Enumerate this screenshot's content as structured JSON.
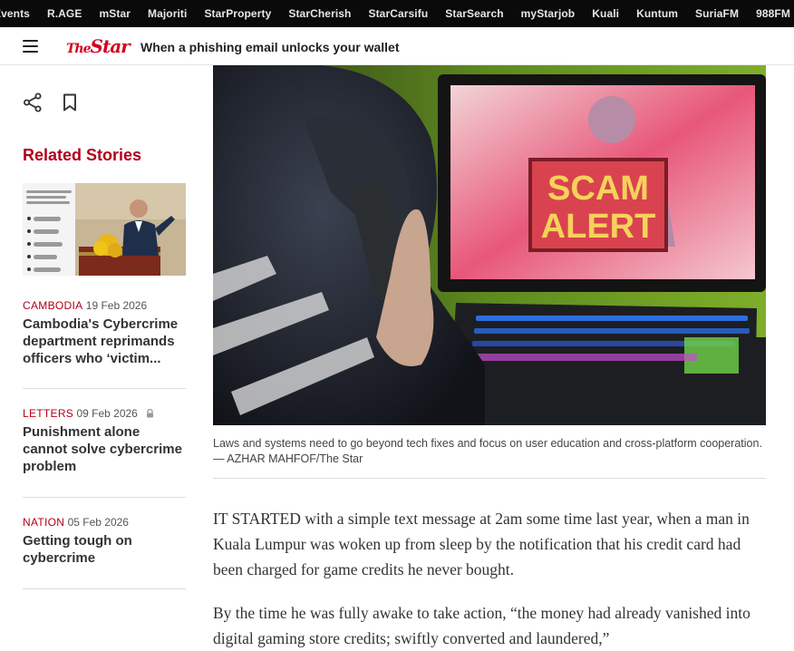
{
  "topnav": [
    "Events",
    "R.AGE",
    "mStar",
    "Majoriti",
    "StarProperty",
    "StarCherish",
    "StarCarsifu",
    "StarSearch",
    "myStarjob",
    "Kuali",
    "Kuntum",
    "SuriaFM",
    "988FM"
  ],
  "header": {
    "logo_the": "The",
    "logo_star": "Star",
    "headline": "When a phishing email unlocks your wallet"
  },
  "related": {
    "title": "Related Stories",
    "stories": [
      {
        "category": "CAMBODIA",
        "date": "19 Feb 2026",
        "title": "Cambodia's Cybercrime department reprimands officers who ‘victim..."
      },
      {
        "category": "LETTERS",
        "date": "09 Feb 2026",
        "title": "Punishment alone cannot solve cybercrime problem"
      },
      {
        "category": "NATION",
        "date": "05 Feb 2026",
        "title": "Getting tough on cybercrime"
      }
    ]
  },
  "hero": {
    "screen_text_line1": "SCAM",
    "screen_text_line2": "ALERT"
  },
  "caption": "Laws and systems need to go beyond tech fixes and focus on user education and cross-platform cooperation. — AZHAR MAHFOF/The Star",
  "article": {
    "paragraphs": [
      "IT STARTED with a simple text message at 2am some time last year, when a man in Kuala Lumpur was woken up from sleep by the notification that his credit card had been charged for game credits he never bought.",
      "By the time he was fully awake to take action, “the money had already vanished into digital gaming store credits; swiftly converted and laundered,”"
    ]
  },
  "colors": {
    "brand_red": "#d2001f",
    "category_red": "#b2001a",
    "topbar_bg": "#0a0a0a"
  }
}
